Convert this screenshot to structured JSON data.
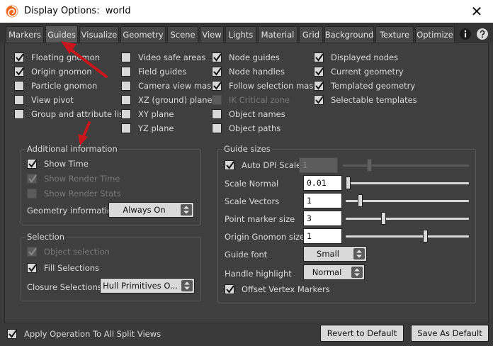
{
  "window": {
    "title": "Display Options:  world",
    "close_glyph": "✕"
  },
  "tabs": [
    {
      "label": "Markers"
    },
    {
      "label": "Guides",
      "active": true
    },
    {
      "label": "Visualize"
    },
    {
      "label": "Geometry"
    },
    {
      "label": "Scene"
    },
    {
      "label": "View"
    },
    {
      "label": "Lights"
    },
    {
      "label": "Material"
    },
    {
      "label": "Grid"
    },
    {
      "label": "Background"
    },
    {
      "label": "Texture"
    },
    {
      "label": "Optimize"
    }
  ],
  "tab_icons": [
    "info-icon",
    "help-icon"
  ],
  "guides": {
    "col1": [
      {
        "label": "Floating gnomon",
        "checked": true
      },
      {
        "label": "Origin gnomon",
        "checked": true
      },
      {
        "label": "Particle gnomon",
        "checked": false
      },
      {
        "label": "View pivot",
        "checked": false
      },
      {
        "label": "Group and attribute list",
        "checked": false
      }
    ],
    "col2": [
      {
        "label": "Video safe areas",
        "checked": false
      },
      {
        "label": "Field guides",
        "checked": false
      },
      {
        "label": "Camera view mask",
        "checked": false
      },
      {
        "label": "XZ (ground) plane",
        "checked": false
      },
      {
        "label": "XY plane",
        "checked": false
      },
      {
        "label": "YZ plane",
        "checked": false
      }
    ],
    "col3": [
      {
        "label": "Node guides",
        "checked": true
      },
      {
        "label": "Node handles",
        "checked": true
      },
      {
        "label": "Follow selection mask",
        "checked": true
      },
      {
        "label": "IK Critical zone",
        "checked": false,
        "disabled": true
      },
      {
        "label": "Object names",
        "checked": false
      },
      {
        "label": "Object paths",
        "checked": false
      }
    ],
    "col4": [
      {
        "label": "Displayed nodes",
        "checked": true
      },
      {
        "label": "Current geometry",
        "checked": true
      },
      {
        "label": "Templated geometry",
        "checked": true
      },
      {
        "label": "Selectable templates",
        "checked": true
      }
    ]
  },
  "additional_info": {
    "title": "Additional information",
    "show_time": "Show Time",
    "show_render_time": "Show Render Time",
    "show_render_stats": "Show Render Stats",
    "geometry_info_label": "Geometry information",
    "geometry_info_value": "Always On"
  },
  "selection": {
    "title": "Selection",
    "object_selection": "Object selection",
    "fill_selections": "Fill Selections",
    "closure_label": "Closure Selections",
    "closure_value": "Hull Primitives O..."
  },
  "guide_sizes": {
    "title": "Guide sizes",
    "auto_dpi": "Auto DPI Scale",
    "auto_dpi_value": "1",
    "rows": [
      {
        "label": "Scale Normal",
        "value": "0.01",
        "level": 0.0
      },
      {
        "label": "Scale Vectors",
        "value": "1",
        "level": 0.1
      },
      {
        "label": "Point marker size",
        "value": "3",
        "level": 0.3
      },
      {
        "label": "Origin Gnomon size",
        "value": "1",
        "level": 0.65
      }
    ],
    "auto_dpi_level": 0.2,
    "guide_font_label": "Guide font",
    "guide_font_value": "Small",
    "handle_highlight_label": "Handle highlight",
    "handle_highlight_value": "Normal",
    "offset_vertex": "Offset Vertex Markers"
  },
  "footer": {
    "apply_all": "Apply Operation To All Split Views",
    "revert": "Revert to Default",
    "save": "Save As Default"
  },
  "annotation_color": "#c8161d"
}
